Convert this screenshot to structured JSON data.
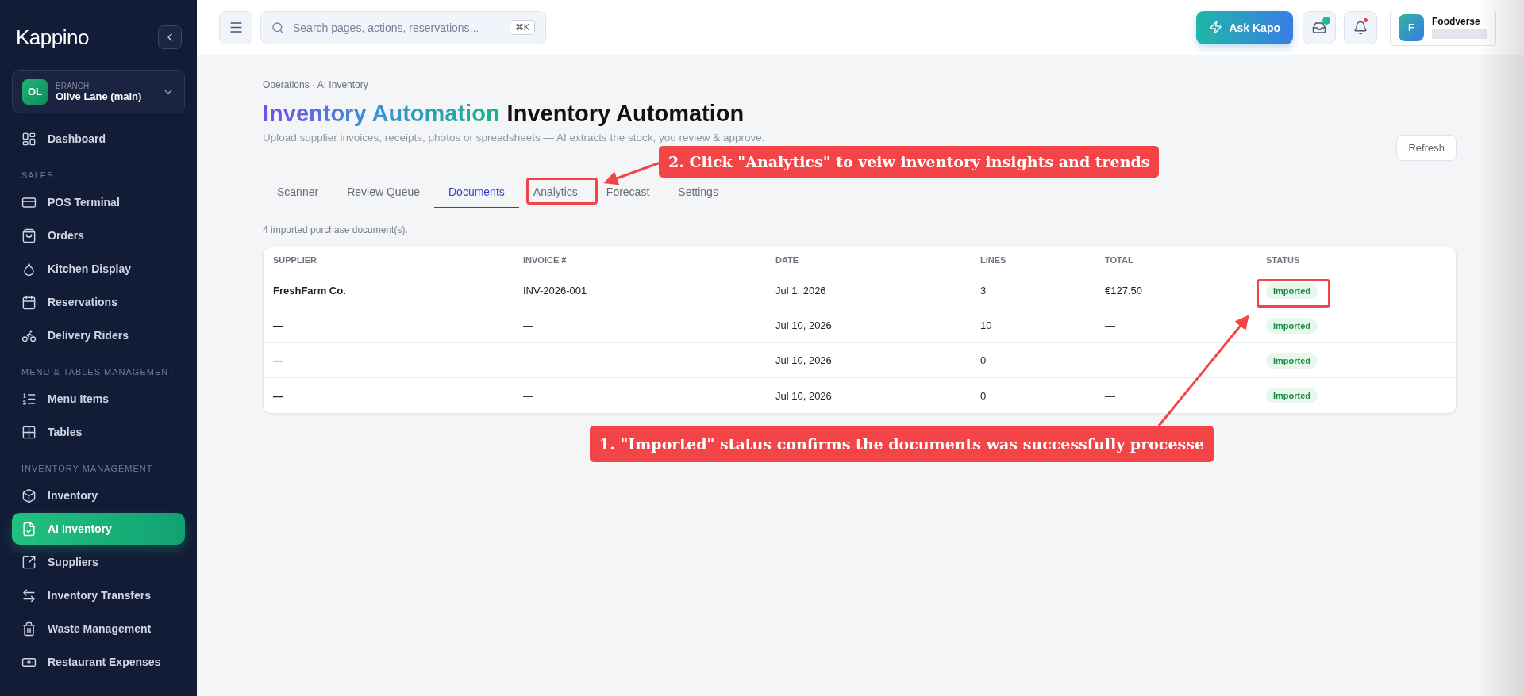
{
  "sidebar": {
    "logo": "Kappino",
    "branch": {
      "initials": "OL",
      "label": "BRANCH",
      "name": "Olive Lane (main)"
    },
    "sections": [
      {
        "items": [
          {
            "label": "Dashboard",
            "selected": false
          }
        ]
      },
      {
        "heading": "SALES",
        "items": [
          {
            "label": "POS Terminal",
            "selected": false
          },
          {
            "label": "Orders",
            "selected": false
          },
          {
            "label": "Kitchen Display",
            "selected": false
          },
          {
            "label": "Reservations",
            "selected": false
          },
          {
            "label": "Delivery Riders",
            "selected": false
          }
        ]
      },
      {
        "heading": "MENU & TABLES MANAGEMENT",
        "items": [
          {
            "label": "Menu Items",
            "selected": false
          },
          {
            "label": "Tables",
            "selected": false
          }
        ]
      },
      {
        "heading": "INVENTORY MANAGEMENT",
        "items": [
          {
            "label": "Inventory",
            "selected": false
          },
          {
            "label": "AI Inventory",
            "selected": true
          },
          {
            "label": "Suppliers",
            "selected": false
          },
          {
            "label": "Inventory Transfers",
            "selected": false
          },
          {
            "label": "Waste Management",
            "selected": false
          },
          {
            "label": "Restaurant Expenses",
            "selected": false
          }
        ]
      }
    ]
  },
  "topbar": {
    "search": {
      "placeholder": "Search pages, actions, reservations...",
      "shortcut": "⌘K"
    },
    "ask_button": "Ask Kapo",
    "profile": {
      "initial": "F",
      "name": "Foodverse"
    }
  },
  "page": {
    "breadcrumb": "Operations · AI Inventory",
    "title_gradient": "Inventory Automation",
    "title": "Inventory Automation",
    "subtitle": "Upload supplier invoices, receipts, photos or spreadsheets — AI extracts the stock, you review & approve.",
    "refresh": "Refresh",
    "tabs": [
      {
        "label": "Scanner",
        "selected": false
      },
      {
        "label": "Review Queue",
        "selected": false
      },
      {
        "label": "Documents",
        "selected": true
      },
      {
        "label": "Analytics",
        "selected": false
      },
      {
        "label": "Forecast",
        "selected": false
      },
      {
        "label": "Settings",
        "selected": false
      }
    ],
    "count_note": "4 imported purchase document(s).",
    "table": {
      "columns": [
        "SUPPLIER",
        "INVOICE #",
        "DATE",
        "LINES",
        "TOTAL",
        "STATUS"
      ],
      "rows": [
        {
          "supplier": "FreshFarm Co.",
          "invoice": "INV-2026-001",
          "date": "Jul 1, 2026",
          "lines": "3",
          "total": "€127.50",
          "status": "Imported"
        },
        {
          "supplier": "—",
          "invoice": "—",
          "date": "Jul 10, 2026",
          "lines": "10",
          "total": "—",
          "status": "Imported"
        },
        {
          "supplier": "—",
          "invoice": "—",
          "date": "Jul 10, 2026",
          "lines": "0",
          "total": "—",
          "status": "Imported"
        },
        {
          "supplier": "—",
          "invoice": "—",
          "date": "Jul 10, 2026",
          "lines": "0",
          "total": "—",
          "status": "Imported"
        }
      ]
    }
  },
  "annotations": [
    {
      "text": "2. Click \"Analytics\" to  veiw inventory insights and trends"
    },
    {
      "text": "1. \"Imported\" status confirms the documents was successfully processe"
    }
  ]
}
